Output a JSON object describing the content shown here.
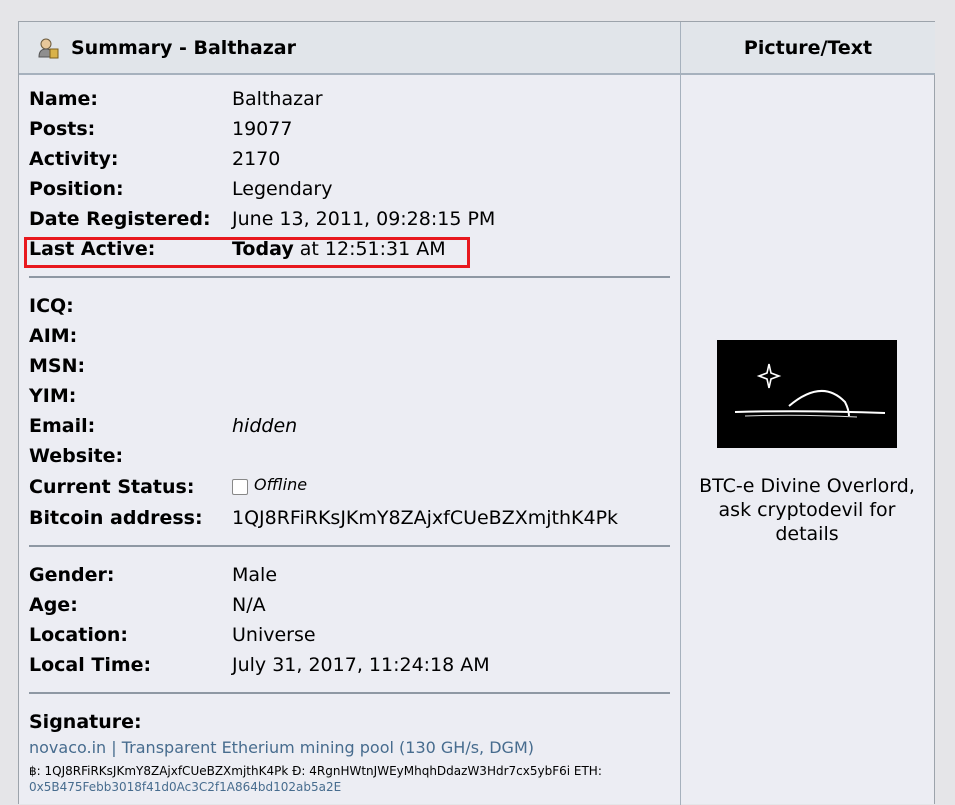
{
  "header": {
    "title": "Summary - Balthazar",
    "right_title": "Picture/Text"
  },
  "profile": {
    "name_label": "Name:",
    "name": "Balthazar",
    "posts_label": "Posts:",
    "posts": "19077",
    "activity_label": "Activity:",
    "activity": "2170",
    "position_label": "Position:",
    "position": "Legendary",
    "registered_label": "Date Registered:",
    "registered": "June 13, 2011, 09:28:15 PM",
    "last_active_label": "Last Active:",
    "last_active_bold": "Today",
    "last_active_rest": " at 12:51:31 AM"
  },
  "contact": {
    "icq_label": "ICQ:",
    "aim_label": "AIM:",
    "msn_label": "MSN:",
    "yim_label": "YIM:",
    "email_label": "Email:",
    "email": "hidden",
    "website_label": "Website:",
    "status_label": "Current Status:",
    "status": "Offline",
    "bitcoin_label": "Bitcoin address:",
    "bitcoin": "1QJ8RFiRKsJKmY8ZAjxfCUeBZXmjthK4Pk"
  },
  "personal": {
    "gender_label": "Gender:",
    "gender": "Male",
    "age_label": "Age:",
    "age": "N/A",
    "location_label": "Location:",
    "location": "Universe",
    "local_time_label": "Local Time:",
    "local_time": "July 31, 2017, 11:24:18 AM"
  },
  "signature": {
    "label": "Signature:",
    "link1": "novaco.in",
    "divider": " | ",
    "link2": "Transparent Etherium mining pool (130 GH/s, DGM)",
    "line2": "฿: 1QJ8RFiRKsJKmY8ZAjxfCUeBZXmjthK4Pk Ɖ: 4RgnHWtnJWEyMhqhDdazW3Hdr7cx5ybF6i ETH:",
    "line3": "0x5B475Febb3018f41d0Ac3C2f1A864bd102ab5a2E"
  },
  "avatar": {
    "caption": "BTC-e Divine Overlord, ask cryptodevil for details"
  },
  "colors": {
    "highlight": "#e8181e",
    "link": "#476c8e"
  }
}
